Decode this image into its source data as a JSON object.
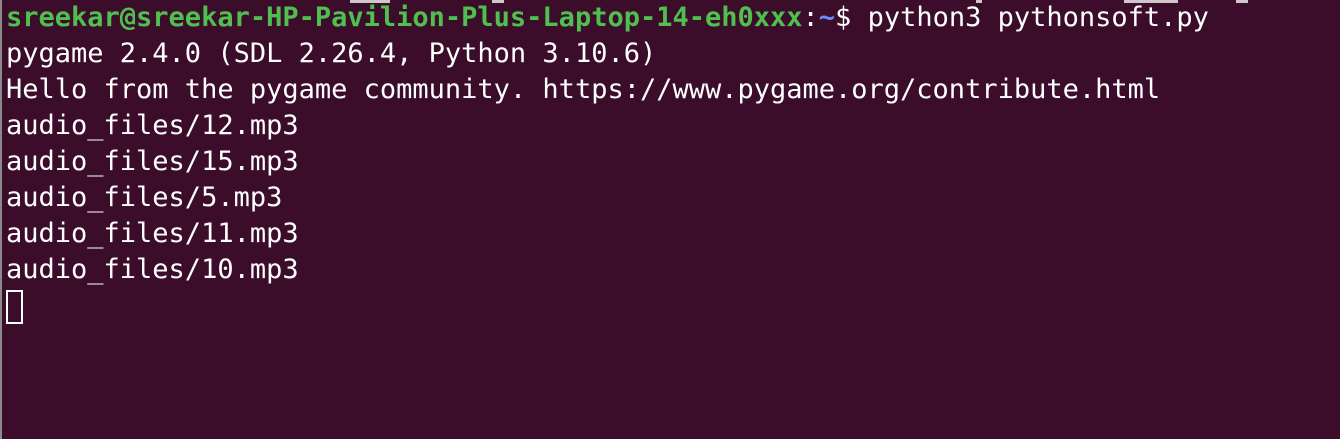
{
  "terminal": {
    "background": "#3b0d2b",
    "prompt": {
      "user_host": "sreekar@sreekar-HP-Pavilion-Plus-Laptop-14-eh0xxx",
      "colon": ":",
      "path": "~",
      "symbol": "$ ",
      "command": "python3 pythonsoft.py",
      "user_color": "#4fc04f",
      "path_color": "#6a8cff"
    },
    "output": [
      "pygame 2.4.0 (SDL 2.26.4, Python 3.10.6)",
      "Hello from the pygame community. https://www.pygame.org/contribute.html",
      "audio_files/12.mp3",
      "audio_files/15.mp3",
      "audio_files/5.mp3",
      "audio_files/11.mp3",
      "audio_files/10.mp3"
    ]
  }
}
